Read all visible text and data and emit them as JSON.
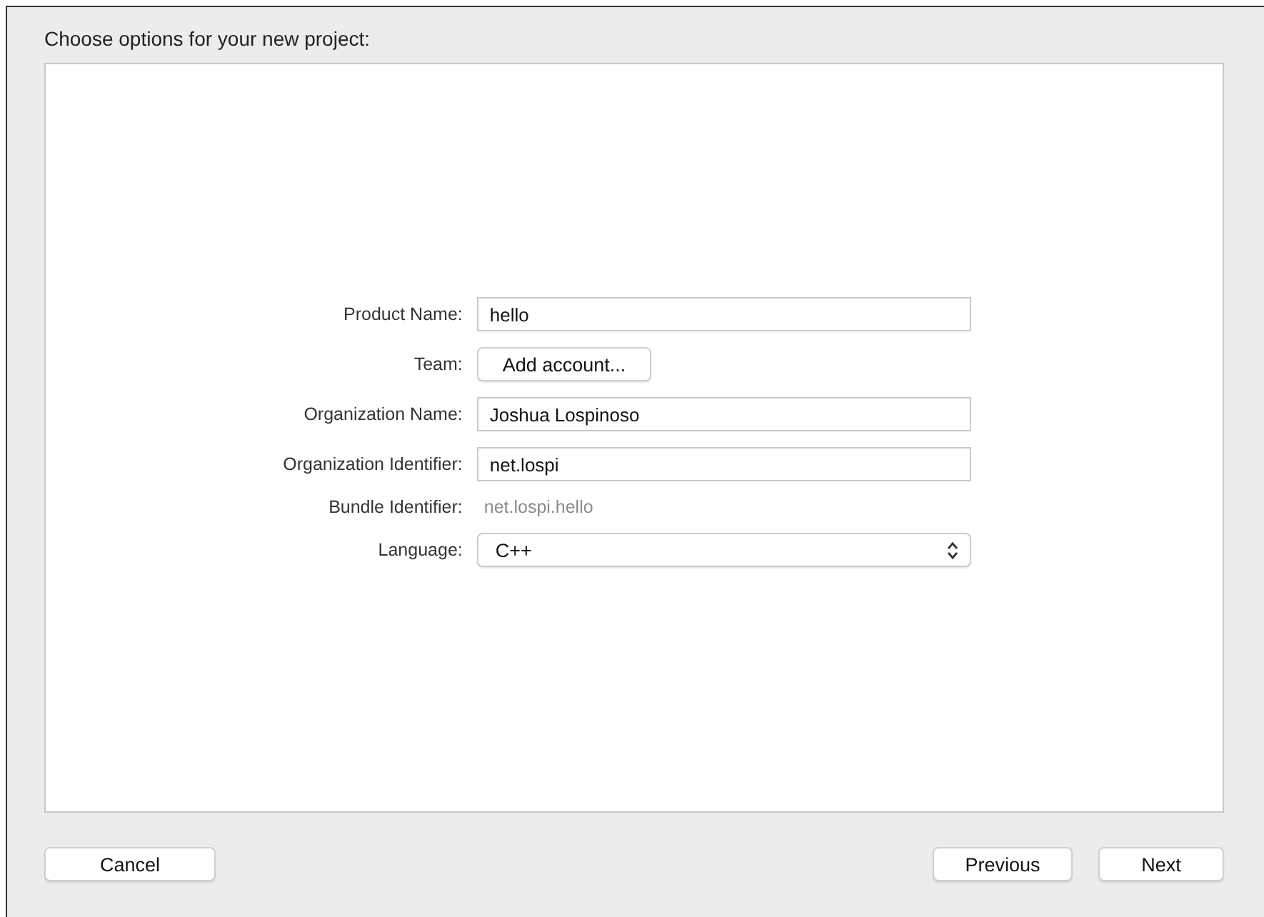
{
  "header": "Choose options for your new project:",
  "fields": [
    {
      "kind": "text",
      "label": "Product Name:",
      "value": "hello"
    },
    {
      "kind": "button",
      "label": "Team:",
      "value": "Add account..."
    },
    {
      "kind": "text",
      "label": "Organization Name:",
      "value": "Joshua Lospinoso"
    },
    {
      "kind": "text",
      "label": "Organization Identifier:",
      "value": "net.lospi"
    },
    {
      "kind": "static",
      "label": "Bundle Identifier:",
      "value": "net.lospi.hello"
    },
    {
      "kind": "select",
      "label": "Language:",
      "value": "C++"
    }
  ],
  "buttons": {
    "left": [
      "Cancel"
    ],
    "right": [
      "Previous",
      "Next"
    ]
  }
}
